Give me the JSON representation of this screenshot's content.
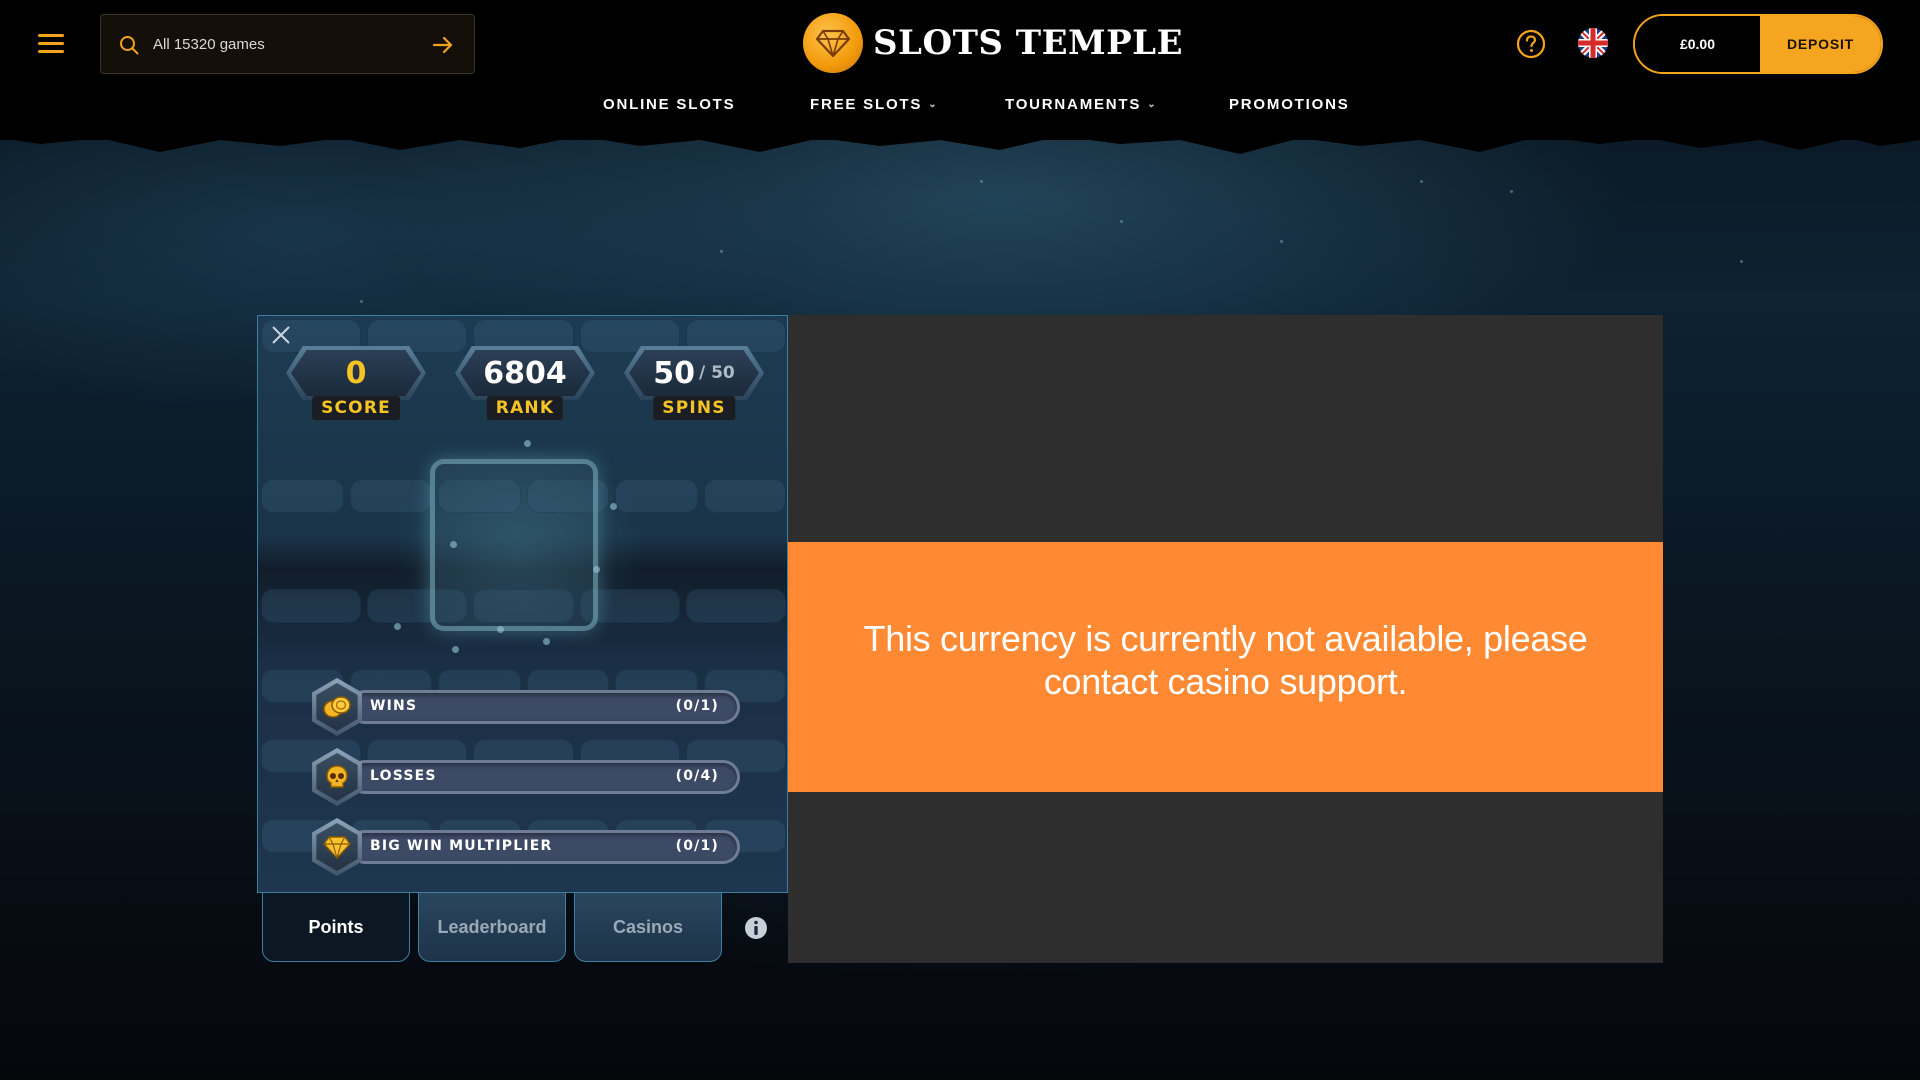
{
  "search": {
    "placeholder": "All 15320 games"
  },
  "logo": {
    "text": "SLOTS TEMPLE"
  },
  "header": {
    "balance": "£0.00",
    "deposit_label": "DEPOSIT"
  },
  "nav": {
    "items": [
      {
        "label": "ONLINE SLOTS",
        "has_dropdown": false
      },
      {
        "label": "FREE SLOTS",
        "has_dropdown": true
      },
      {
        "label": "TOURNAMENTS",
        "has_dropdown": true
      },
      {
        "label": "PROMOTIONS",
        "has_dropdown": false
      }
    ]
  },
  "tournament": {
    "stats": [
      {
        "value": "0",
        "label": "SCORE"
      },
      {
        "value": "6804",
        "label": "RANK"
      },
      {
        "value": "50",
        "sub": "/ 50",
        "label": "SPINS"
      }
    ],
    "missions": [
      {
        "name": "WINS",
        "progress": "(0/1)",
        "icon": "coins-icon"
      },
      {
        "name": "LOSSES",
        "progress": "(0/4)",
        "icon": "skull-icon"
      },
      {
        "name": "BIG WIN MULTIPLIER",
        "progress": "(0/1)",
        "icon": "diamond-icon"
      }
    ],
    "tabs": [
      {
        "label": "Points",
        "active": true
      },
      {
        "label": "Leaderboard",
        "active": false
      },
      {
        "label": "Casinos",
        "active": false
      }
    ]
  },
  "game": {
    "error_message": "This currency is currently not available, please contact casino support."
  },
  "colors": {
    "accent": "#f5a51f",
    "error_band": "#ff8a33",
    "score_gold": "#f6c325",
    "widget_border": "#3e7fa1"
  }
}
